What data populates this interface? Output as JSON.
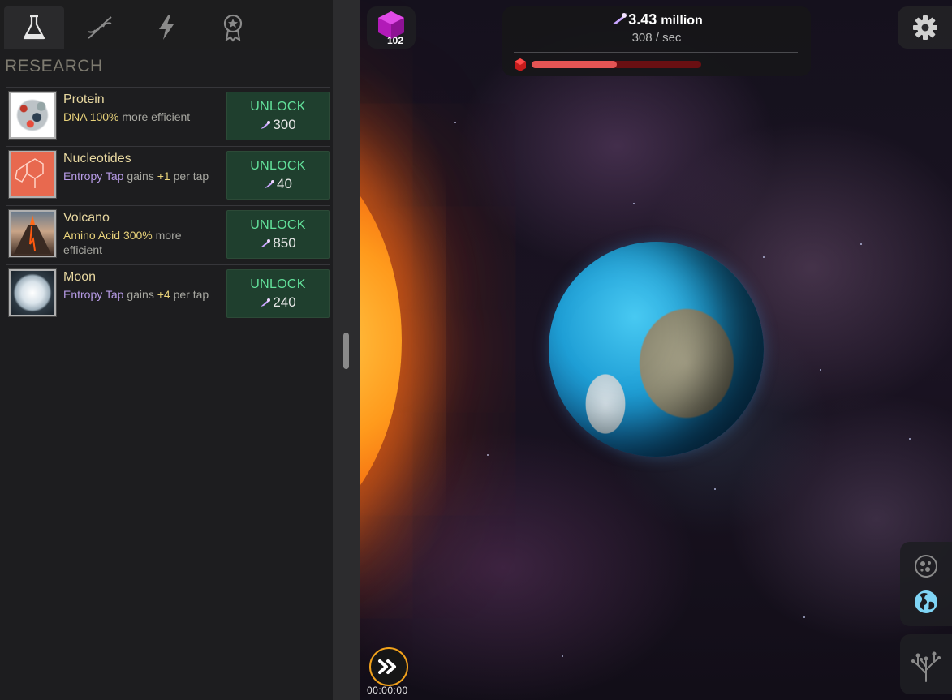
{
  "panel": {
    "title": "RESEARCH",
    "tabs": [
      {
        "icon": "flask-icon",
        "active": true
      },
      {
        "icon": "dna-icon",
        "active": false
      },
      {
        "icon": "lightning-icon",
        "active": false
      },
      {
        "icon": "award-icon",
        "active": false
      }
    ],
    "items": [
      {
        "name": "Protein",
        "thumb_icon": "protein-thumbnail",
        "desc_parts": {
          "lead": "DNA",
          "amount": "100%",
          "rest": "more efficient"
        },
        "unlock_label": "UNLOCK",
        "cost": "300"
      },
      {
        "name": "Nucleotides",
        "thumb_icon": "nucleotides-thumbnail",
        "desc_parts": {
          "lead": "Entropy Tap",
          "mid": "gains",
          "amount": "+1",
          "rest": "per tap"
        },
        "unlock_label": "UNLOCK",
        "cost": "40"
      },
      {
        "name": "Volcano",
        "thumb_icon": "volcano-thumbnail",
        "desc_parts": {
          "lead": "Amino Acid",
          "amount": "300%",
          "rest": "more efficient"
        },
        "unlock_label": "UNLOCK",
        "cost": "850"
      },
      {
        "name": "Moon",
        "thumb_icon": "moon-thumbnail",
        "desc_parts": {
          "lead": "Entropy Tap",
          "mid": "gains",
          "amount": "+4",
          "rest": "per tap"
        },
        "unlock_label": "UNLOCK",
        "cost": "240"
      }
    ]
  },
  "hud": {
    "gem_count": "102",
    "entropy_value": "3.43",
    "entropy_unit": "million",
    "rate": "308 / sec",
    "progress_fraction": 0.5,
    "settings_icon": "gear-icon"
  },
  "fast_forward": {
    "icon": "fast-forward-icon",
    "timer": "00:00:00"
  },
  "view_switch": {
    "icons": [
      "cell-icon",
      "globe-icon",
      "tree-icon"
    ]
  },
  "colors": {
    "accent_green": "#62e09a",
    "unlock_bg": "#1f3f2e",
    "highlight_yellow": "#e8d27a",
    "highlight_purple": "#b79be6",
    "progress_fill": "#e45454",
    "progress_track": "#6a0f12",
    "ff_ring": "#f2a21b"
  }
}
